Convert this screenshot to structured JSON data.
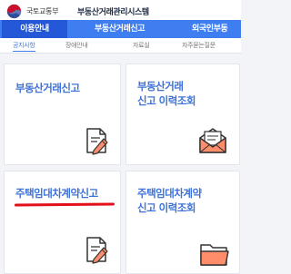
{
  "header": {
    "ministry": "국토교통부",
    "system_title": "부동산거래관리시스템"
  },
  "main_nav": {
    "tabs": [
      {
        "label": "이용안내",
        "active": true
      },
      {
        "label": "부동산거래신고",
        "active": false
      },
      {
        "label": "외국인부동",
        "active": false
      }
    ]
  },
  "sub_nav": {
    "tabs": [
      {
        "label": "공지사항",
        "active": true
      },
      {
        "label": "장애안내",
        "active": false
      },
      {
        "label": "자료실",
        "active": false
      },
      {
        "label": "자주묻는질문",
        "active": false
      }
    ]
  },
  "cards": [
    {
      "title": "부동산거래신고",
      "icon": "document-pen-icon"
    },
    {
      "title": "부동산거래\n신고 이력조회",
      "icon": "envelope-icon"
    },
    {
      "title": "주택임대차계약신고",
      "icon": "document-pen-icon"
    },
    {
      "title": "주택임대차계약\n신고 이력조회",
      "icon": "folder-icon"
    }
  ],
  "colors": {
    "primary": "#3f7ef1",
    "active_tab": "#2458d6",
    "card_title": "#3e72d7",
    "annotation": "#e30f1a"
  }
}
